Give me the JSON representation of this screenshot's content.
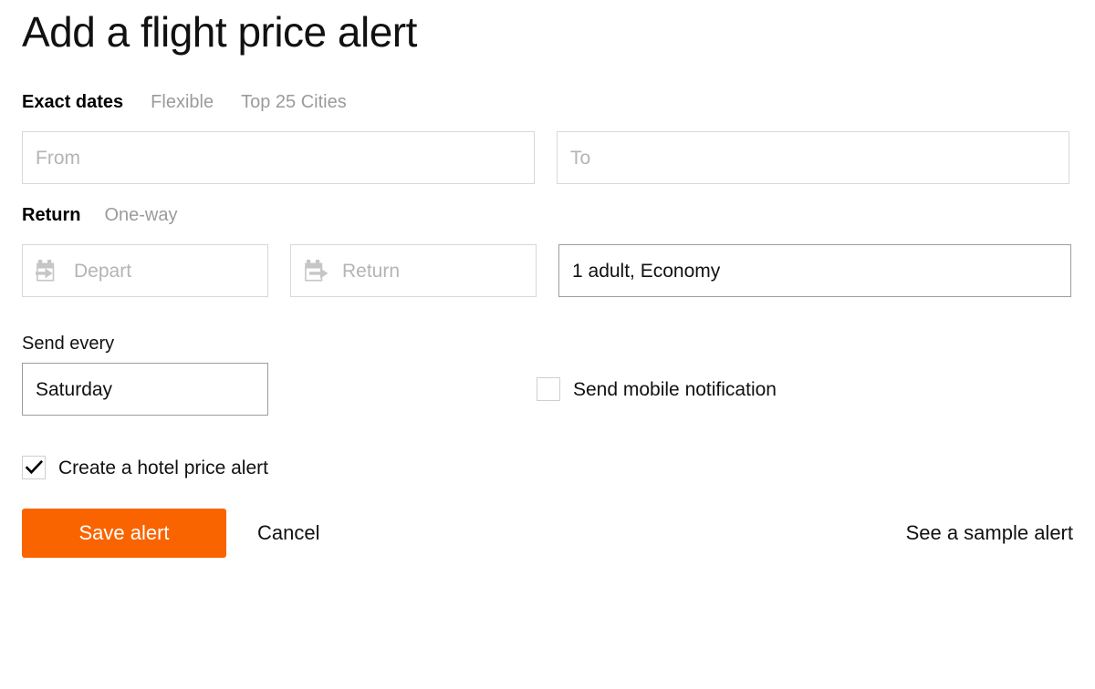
{
  "header": {
    "title": "Add a flight price alert"
  },
  "date_mode_tabs": [
    {
      "label": "Exact dates",
      "active": true,
      "name": "tab-exact-dates"
    },
    {
      "label": "Flexible",
      "active": false,
      "name": "tab-flexible"
    },
    {
      "label": "Top 25 Cities",
      "active": false,
      "name": "tab-top-25-cities"
    }
  ],
  "route": {
    "from": {
      "value": "",
      "placeholder": "From"
    },
    "to": {
      "value": "",
      "placeholder": "To"
    }
  },
  "trip_type_tabs": [
    {
      "label": "Return",
      "active": true,
      "name": "tab-return"
    },
    {
      "label": "One-way",
      "active": false,
      "name": "tab-one-way"
    }
  ],
  "dates": {
    "depart": {
      "value": "",
      "placeholder": "Depart",
      "icon": "calendar-arrow-in-icon"
    },
    "return": {
      "value": "",
      "placeholder": "Return",
      "icon": "calendar-arrow-out-icon"
    }
  },
  "passengers": {
    "value": "1 adult, Economy",
    "placeholder": "1 adult, Economy"
  },
  "send_every": {
    "label": "Send every",
    "value": "Saturday",
    "options": [
      "Saturday"
    ]
  },
  "mobile_notification": {
    "label": "Send mobile notification",
    "checked": false
  },
  "hotel_alert": {
    "label": "Create a hotel price alert",
    "checked": true
  },
  "actions": {
    "save_label": "Save alert",
    "cancel_label": "Cancel",
    "sample_label": "See a sample alert"
  },
  "colors": {
    "accent": "#fa6400",
    "text": "#111111",
    "muted": "#9b9b9b",
    "placeholder": "#b4b4b4",
    "border": "#d8d8d8",
    "border_active": "#9d9d9d"
  }
}
